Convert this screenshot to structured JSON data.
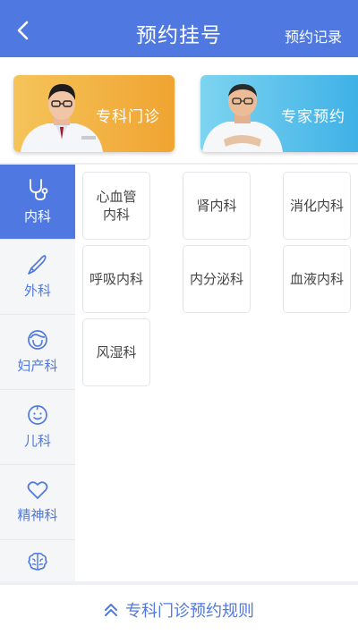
{
  "header": {
    "title": "预约挂号",
    "right_action": "预约记录",
    "back_icon": "back-arrow-icon",
    "bg_color": "#4f78e0"
  },
  "banners": [
    {
      "label": "专科门诊",
      "color": "#f0a431"
    },
    {
      "label": "专家预约",
      "color": "#3fb1e6"
    }
  ],
  "sidebar": {
    "items": [
      {
        "label": "内科",
        "icon": "stethoscope-icon",
        "active": true
      },
      {
        "label": "外科",
        "icon": "scalpel-icon",
        "active": false
      },
      {
        "label": "妇产科",
        "icon": "female-face-icon",
        "active": false
      },
      {
        "label": "儿科",
        "icon": "baby-face-icon",
        "active": false
      },
      {
        "label": "精神科",
        "icon": "heart-icon",
        "active": false
      },
      {
        "label": "",
        "icon": "brain-icon",
        "active": false
      }
    ]
  },
  "departments": [
    "心血管内科",
    "肾内科",
    "消化内科",
    "呼吸内科",
    "内分泌科",
    "血液内科",
    "风湿科"
  ],
  "footer": {
    "label": "专科门诊预约规则",
    "icon": "double-chevron-up-icon"
  }
}
